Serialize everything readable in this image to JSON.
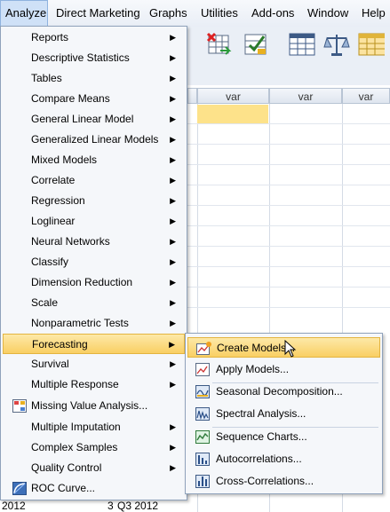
{
  "menubar": [
    "Analyze",
    "Direct Marketing",
    "Graphs",
    "Utilities",
    "Add-ons",
    "Window",
    "Help"
  ],
  "toolbar": {
    "icons": [
      "insert-cases-icon",
      "split-file-icon",
      "value-labels-icon",
      "weight-cases-icon",
      "variable-sets-icon"
    ]
  },
  "grid": {
    "col_header": "var",
    "row_bottom": {
      "year": "2012",
      "index": "3",
      "date": "Q3 2012"
    }
  },
  "analyze_menu": [
    {
      "label": "Reports",
      "submenu": true
    },
    {
      "label": "Descriptive Statistics",
      "submenu": true
    },
    {
      "label": "Tables",
      "submenu": true
    },
    {
      "label": "Compare Means",
      "submenu": true
    },
    {
      "label": "General Linear Model",
      "submenu": true
    },
    {
      "label": "Generalized Linear Models",
      "submenu": true
    },
    {
      "label": "Mixed Models",
      "submenu": true
    },
    {
      "label": "Correlate",
      "submenu": true
    },
    {
      "label": "Regression",
      "submenu": true
    },
    {
      "label": "Loglinear",
      "submenu": true
    },
    {
      "label": "Neural Networks",
      "submenu": true
    },
    {
      "label": "Classify",
      "submenu": true
    },
    {
      "label": "Dimension Reduction",
      "submenu": true
    },
    {
      "label": "Scale",
      "submenu": true
    },
    {
      "label": "Nonparametric Tests",
      "submenu": true
    },
    {
      "label": "Forecasting",
      "submenu": true,
      "highlighted": true
    },
    {
      "label": "Survival",
      "submenu": true
    },
    {
      "label": "Multiple Response",
      "submenu": true
    },
    {
      "label": "Missing Value Analysis...",
      "icon": "missing-value-icon"
    },
    {
      "label": "Multiple Imputation",
      "submenu": true
    },
    {
      "label": "Complex Samples",
      "submenu": true
    },
    {
      "label": "Quality Control",
      "submenu": true
    },
    {
      "label": "ROC Curve...",
      "icon": "roc-curve-icon"
    }
  ],
  "forecasting_menu": [
    {
      "label": "Create Models...",
      "icon": "create-models-icon",
      "highlighted": true
    },
    {
      "label": "Apply Models...",
      "icon": "apply-models-icon"
    },
    {
      "label": "Seasonal Decomposition...",
      "icon": "seasonal-decomposition-icon"
    },
    {
      "label": "Spectral Analysis...",
      "icon": "spectral-analysis-icon"
    },
    {
      "label": "Sequence Charts...",
      "icon": "sequence-charts-icon"
    },
    {
      "label": "Autocorrelations...",
      "icon": "autocorrelations-icon"
    },
    {
      "label": "Cross-Correlations...",
      "icon": "cross-correlations-icon"
    }
  ],
  "colors": {
    "highlight": "#f9cf63",
    "menu_bg": "#f5f7fa",
    "selected_cell": "#fde28a",
    "menubar_active": "#cfe1f7"
  }
}
